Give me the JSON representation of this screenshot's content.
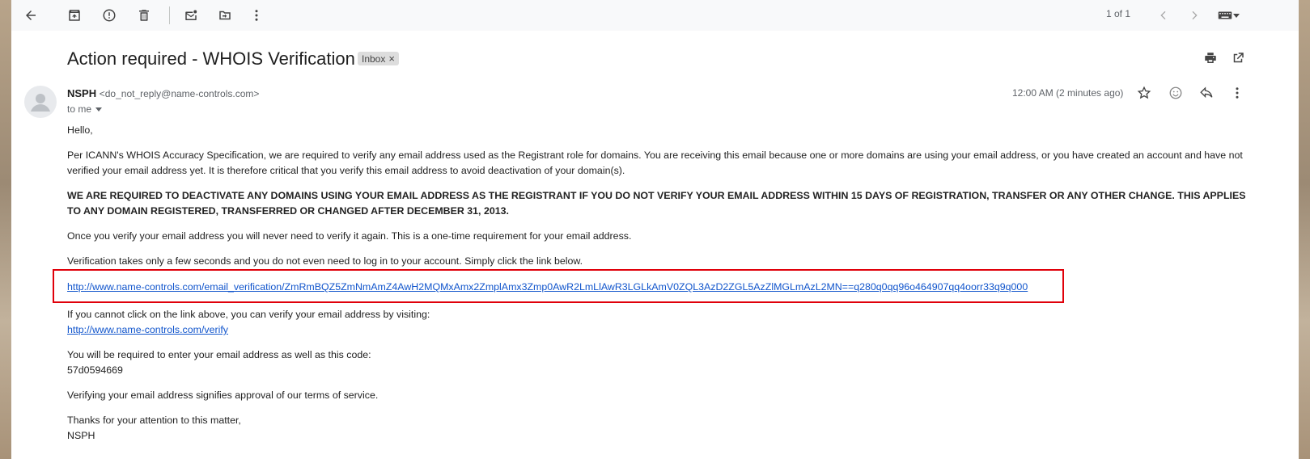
{
  "toolbar": {
    "page_count": "1 of 1"
  },
  "email": {
    "subject": "Action required - WHOIS Verification",
    "label": "Inbox",
    "sender_name": "NSPH",
    "sender_email": "<do_not_reply@name-controls.com>",
    "recipient": "to me",
    "timestamp": "12:00 AM (2 minutes ago)"
  },
  "body": {
    "greeting": "Hello,",
    "para1": "Per ICANN's WHOIS Accuracy Specification, we are required to verify any email address used as the Registrant role for domains. You are receiving this email because one or more domains are using your email address, or you have created an account and have not verified your email address yet. It is therefore critical that you verify this email address to avoid deactivation of your domain(s).",
    "warning": "WE ARE REQUIRED TO DEACTIVATE ANY DOMAINS USING YOUR EMAIL ADDRESS AS THE REGISTRANT IF YOU DO NOT VERIFY YOUR EMAIL ADDRESS WITHIN 15 DAYS OF REGISTRATION, TRANSFER OR ANY OTHER CHANGE. THIS APPLIES TO ANY DOMAIN REGISTERED, TRANSFERRED OR CHANGED AFTER DECEMBER 31, 2013.",
    "para2": "Once you verify your email address you will never need to verify it again. This is a one-time requirement for your email address.",
    "para3": "Verification takes only a few seconds and you do not even need to log in to your account. Simply click the link below.",
    "verification_link": "http://www.name-controls.com/email_verification/ZmRmBQZ5ZmNmAmZ4AwH2MQMxAmx2ZmplAmx3Zmp0AwR2LmLlAwR3LGLkAmV0ZQL3AzD2ZGL5AzZlMGLmAzL2MN==q280q0qq96o464907qq4oorr33q9q000",
    "alt_intro": "If you cannot click on the link above, you can verify your email address by visiting:",
    "alt_link": "http://www.name-controls.com/verify",
    "code_intro": "You will be required to enter your email address as well as this code:",
    "code": "57d0594669",
    "terms": "Verifying your email address signifies approval of our terms of service.",
    "thanks": "Thanks for your attention to this matter,",
    "signature": "NSPH"
  },
  "colors": {
    "link": "#1155cc",
    "highlight": "#e0000a"
  }
}
